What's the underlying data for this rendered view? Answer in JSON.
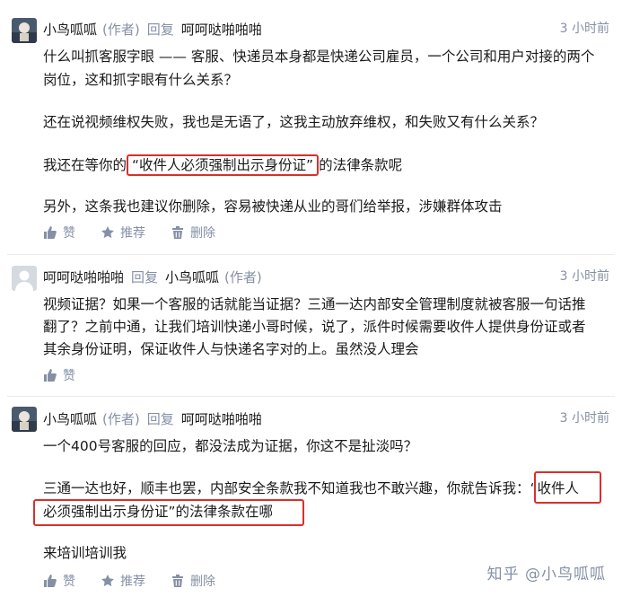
{
  "comments": [
    {
      "author": "小鸟呱呱",
      "author_tag": "(作者)",
      "reply_label": "回复",
      "reply_to": "呵呵哒啪啪啪",
      "time": "3 小时前",
      "lines": [
        "什么叫抓客服字眼 —— 客服、快递员本身都是快递公司雇员，一个公司和用户对接的两个",
        "岗位，这和抓字眼有什么关系？",
        "还在说视频维权失败，我也是无语了，这我主动放弃维权，和失败又有什么关系？"
      ],
      "hl_prefix": "我还在等你的",
      "hl_text": "“收件人必须强制出示身份证”",
      "hl_suffix": "的法律条款呢",
      "last_line": "另外，这条我也建议你删除，容易被快递从业的哥们给举报，涉嫌群体攻击",
      "actions": {
        "like": "赞",
        "recommend": "推荐",
        "delete": "删除"
      }
    },
    {
      "author": "呵呵哒啪啪啪",
      "reply_label": "回复",
      "reply_to": "小鸟呱呱",
      "reply_to_tag": "(作者)",
      "time": "3 小时前",
      "lines": [
        "视频证据？如果一个客服的话就能当证据？三通一达内部安全管理制度就被客服一句话推",
        "翻了？之前中通，让我们培训快递小哥时候，说了，派件时候需要收件人提供身份证或者",
        "其余身份证明，保证收件人与快递名字对的上。虽然没人理会"
      ],
      "actions": {
        "like": "赞"
      }
    },
    {
      "author": "小鸟呱呱",
      "author_tag": "(作者)",
      "reply_label": "回复",
      "reply_to": "呵呵哒啪啪啪",
      "time": "3 小时前",
      "line1": "一个400号客服的回应，都没法成为证据，你这不是扯淡吗？",
      "line2a": "三通一达也好，顺丰也罢，内部安全条款我不知道我也不敢兴趣，你就告诉我：",
      "line2b": "“收件人",
      "line3a": "必须强制出示身份证”",
      "line3b": "的法律条款在哪",
      "line4": "来培训培训我",
      "actions": {
        "like": "赞",
        "recommend": "推荐",
        "delete": "删除"
      }
    }
  ],
  "watermark": "知乎 @小鸟呱呱",
  "colors": {
    "highlight": "#d9302a",
    "meta": "#8590a6",
    "text": "#1a1a1a"
  }
}
